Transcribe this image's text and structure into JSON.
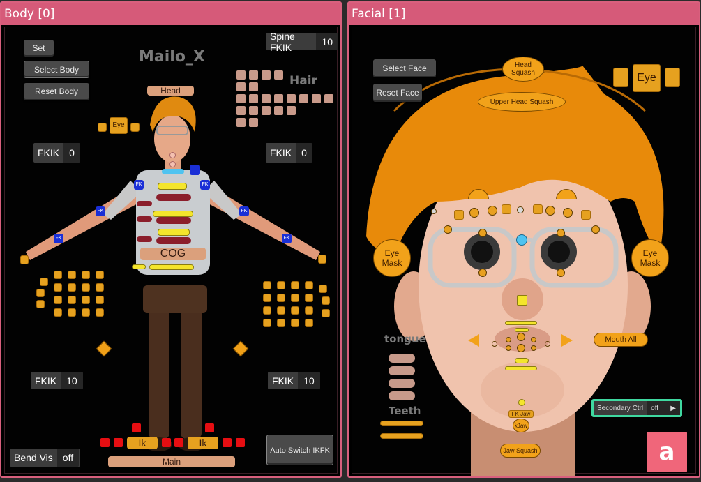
{
  "body_panel": {
    "title": "Body [0]",
    "character_name": "Mailo_X",
    "set_label": "Set",
    "select_body_label": "Select Body",
    "reset_body_label": "Reset Body",
    "spine_fkik": {
      "label": "Spine FKIK",
      "value": "10"
    },
    "hair_label": "Hair",
    "head_label": "Head",
    "eye_label": "Eye",
    "fkik_left_arm": {
      "label": "FKIK",
      "value": "0"
    },
    "fkik_right_arm": {
      "label": "FKIK",
      "value": "0"
    },
    "fkik_left_leg": {
      "label": "FKIK",
      "value": "10"
    },
    "fkik_right_leg": {
      "label": "FKIK",
      "value": "10"
    },
    "fk_tag": "FK",
    "cog_label": "COG",
    "ik_left_label": "Ik",
    "ik_right_label": "Ik",
    "main_label": "Main",
    "bend_vis": {
      "label": "Bend Vis",
      "value": "off"
    },
    "auto_switch_label": "Auto Switch IKFK"
  },
  "facial_panel": {
    "title": "Facial [1]",
    "select_face_label": "Select Face",
    "reset_face_label": "Reset Face",
    "head_squash_label": "Head Squash",
    "upper_head_squash_label": "Upper Head Squash",
    "eye_label": "Eye",
    "eye_mask_left_label": "Eye Mask",
    "eye_mask_right_label": "Eye Mask",
    "mouth_all_label": "Mouth All",
    "tongue_label": "tongue",
    "teeth_label": "Teeth",
    "fk_jaw_label": "FK Jaw",
    "k_jaw_label": "kJaw",
    "jaw_squash_label": "Jaw Squash",
    "secondary_ctrl": {
      "label": "Secondary Ctrl",
      "value": "off"
    },
    "logo_letter": "a"
  },
  "colors": {
    "panel_border": "#d9607e",
    "control_orange": "#f2a21a",
    "control_tan": "#dba07c",
    "accent_green": "#3fd8a0"
  }
}
